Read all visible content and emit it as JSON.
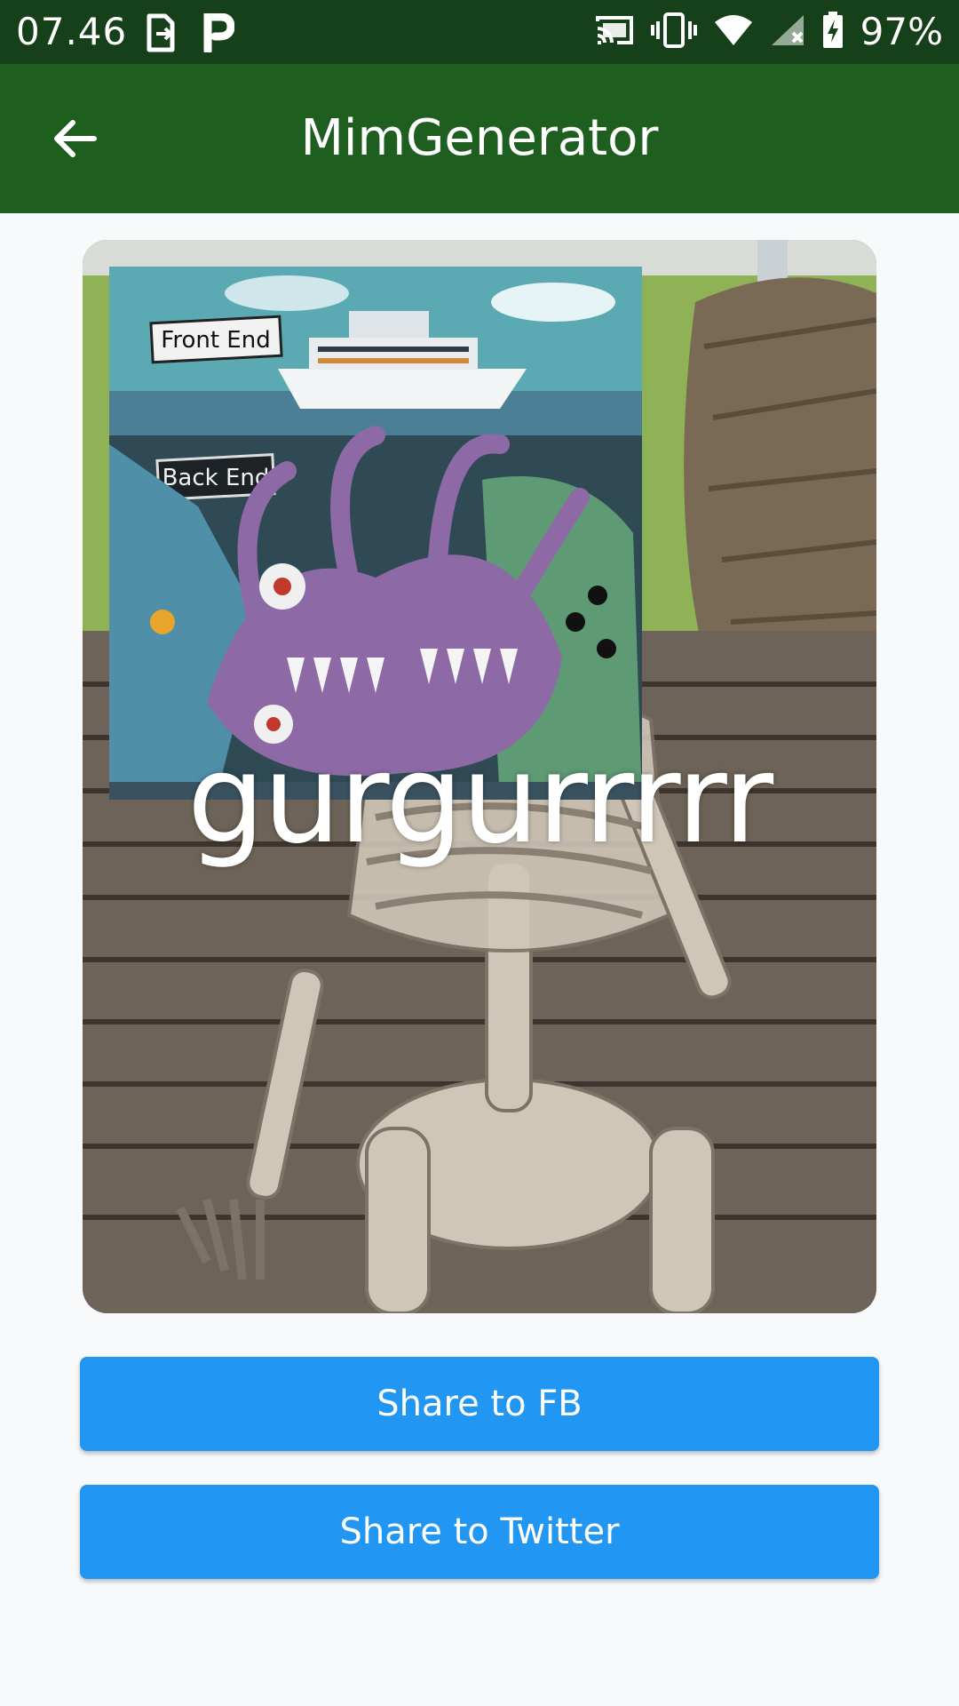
{
  "status_bar": {
    "time": "07.46",
    "battery_percent": "97%",
    "icons": [
      "file-transfer-icon",
      "p-app-icon",
      "cast-icon",
      "vibrate-icon",
      "wifi-icon",
      "signal-icon",
      "battery-charging-icon"
    ]
  },
  "app_bar": {
    "title": "MimGenerator",
    "back_icon": "arrow-back-icon"
  },
  "meme": {
    "caption": "gurgurrrrr",
    "inset_labels": {
      "front": "Front End",
      "back": "Back End"
    }
  },
  "buttons": {
    "share_fb": "Share to FB",
    "share_twitter": "Share to Twitter"
  },
  "colors": {
    "status_bar": "#16401a",
    "app_bar": "#1e5f20",
    "button": "#2196f3",
    "background": "#f8f9fa"
  }
}
